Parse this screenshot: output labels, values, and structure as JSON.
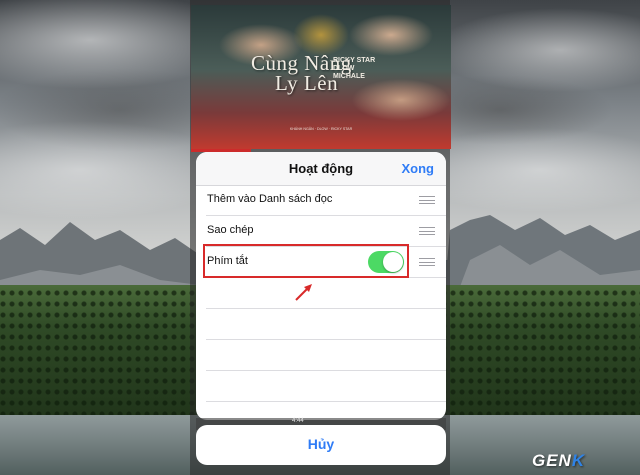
{
  "album": {
    "title_line1": "Cùng Nâng",
    "title_line2": "Ly Lên",
    "artist_block": "RICKY STAR\nDLOW\nMICHALE",
    "small_credits": "KHÁNH NGÂN · DLOW · RICKY STAR"
  },
  "activity_sheet": {
    "title": "Hoạt động",
    "done_label": "Xong",
    "items": [
      {
        "label": "Thêm vào Danh sách đọc",
        "toggle_on": false
      },
      {
        "label": "Sao chép",
        "toggle_on": false
      },
      {
        "label": "Phím tắt",
        "toggle_on": true
      }
    ]
  },
  "behind": {
    "time": "4:44"
  },
  "cancel_label": "Hủy",
  "watermark": {
    "text_main": "GEN",
    "text_accent": "K"
  },
  "colors": {
    "accent": "#2f7cf6",
    "toggle_on": "#4cd964",
    "highlight": "#d82a2a"
  }
}
